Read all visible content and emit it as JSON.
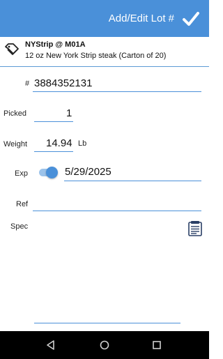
{
  "header": {
    "title": "Add/Edit Lot #",
    "save_icon": "checkmark-icon"
  },
  "item": {
    "name": "NYStrip @ M01A",
    "description": "12 oz New York Strip steak (Carton of 20)",
    "icon": "tag-icon"
  },
  "form": {
    "lot_label": "#",
    "lot_value": "3884352131",
    "picked_label": "Picked",
    "picked_value": "1",
    "weight_label": "Weight",
    "weight_value": "14.94",
    "weight_unit": "Lb",
    "exp_label": "Exp",
    "exp_toggle_on": true,
    "exp_value": "5/29/2025",
    "ref_label": "Ref",
    "ref_value": "",
    "spec_label": "Spec",
    "spec_value": "",
    "spec_icon": "notes-icon"
  },
  "colors": {
    "accent": "#4a90d9",
    "toggle_track": "#9cc3ea",
    "navbar": "#000000"
  },
  "navbar": {
    "icons": [
      "back-icon",
      "home-icon",
      "recents-icon"
    ]
  }
}
